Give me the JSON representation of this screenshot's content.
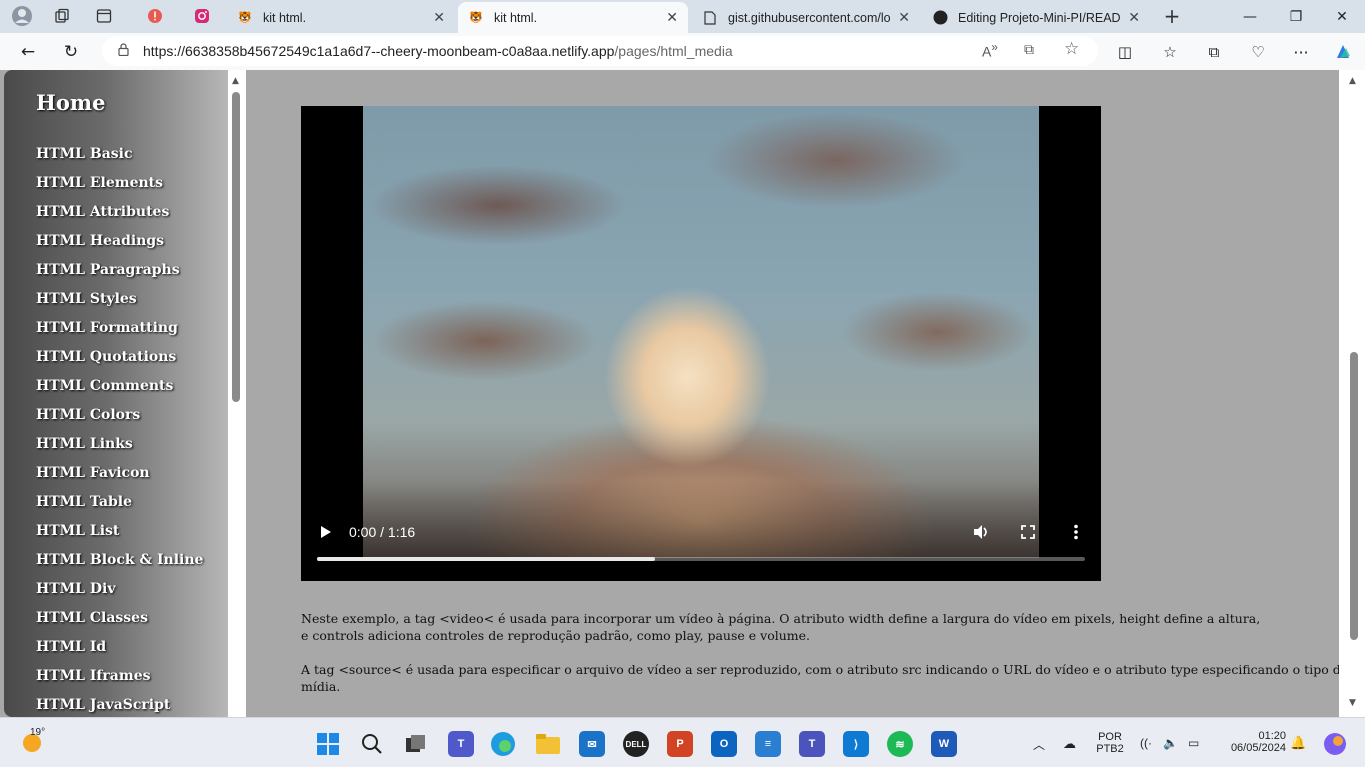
{
  "tabs": [
    {
      "title": "kit html.",
      "active": false
    },
    {
      "title": "kit html.",
      "active": true
    },
    {
      "title": "gist.githubusercontent.com/loh",
      "active": false
    },
    {
      "title": "Editing Projeto-Mini-PI/READM",
      "active": false
    }
  ],
  "address": {
    "host": "https://6638358b45672549c1a1a6d7--cheery-moonbeam-c0a8aa.netlify.app",
    "path": "/pages/html_media"
  },
  "sidebar": {
    "title": "Home",
    "items": [
      "HTML Basic",
      "HTML Elements",
      "HTML Attributes",
      "HTML Headings",
      "HTML Paragraphs",
      "HTML Styles",
      "HTML Formatting",
      "HTML Quotations",
      "HTML Comments",
      "HTML Colors",
      "HTML Links",
      "HTML Favicon",
      "HTML Table",
      "HTML List",
      "HTML Block & Inline",
      "HTML Div",
      "HTML Classes",
      "HTML Id",
      "HTML Iframes",
      "HTML JavaScript"
    ]
  },
  "video": {
    "time": "0:00 / 1:16",
    "progress_fraction": 0.44
  },
  "content": {
    "p1_line1": "Neste exemplo, a tag <video< é usada para incorporar um vídeo à página. O atributo width define a largura do vídeo em pixels, height define a altura,",
    "p1_line2": "e controls adiciona controles de reprodução padrão, como play, pause e volume.",
    "p2": "A tag <source< é usada para especificar o arquivo de vídeo a ser reproduzido, com o atributo src indicando o URL do vídeo e o atributo type especificando o tipo de mídia."
  },
  "taskbar": {
    "weather_temp": "19°",
    "lang_line1": "POR",
    "lang_line2": "PTB2",
    "time": "01:20",
    "date": "06/05/2024"
  }
}
